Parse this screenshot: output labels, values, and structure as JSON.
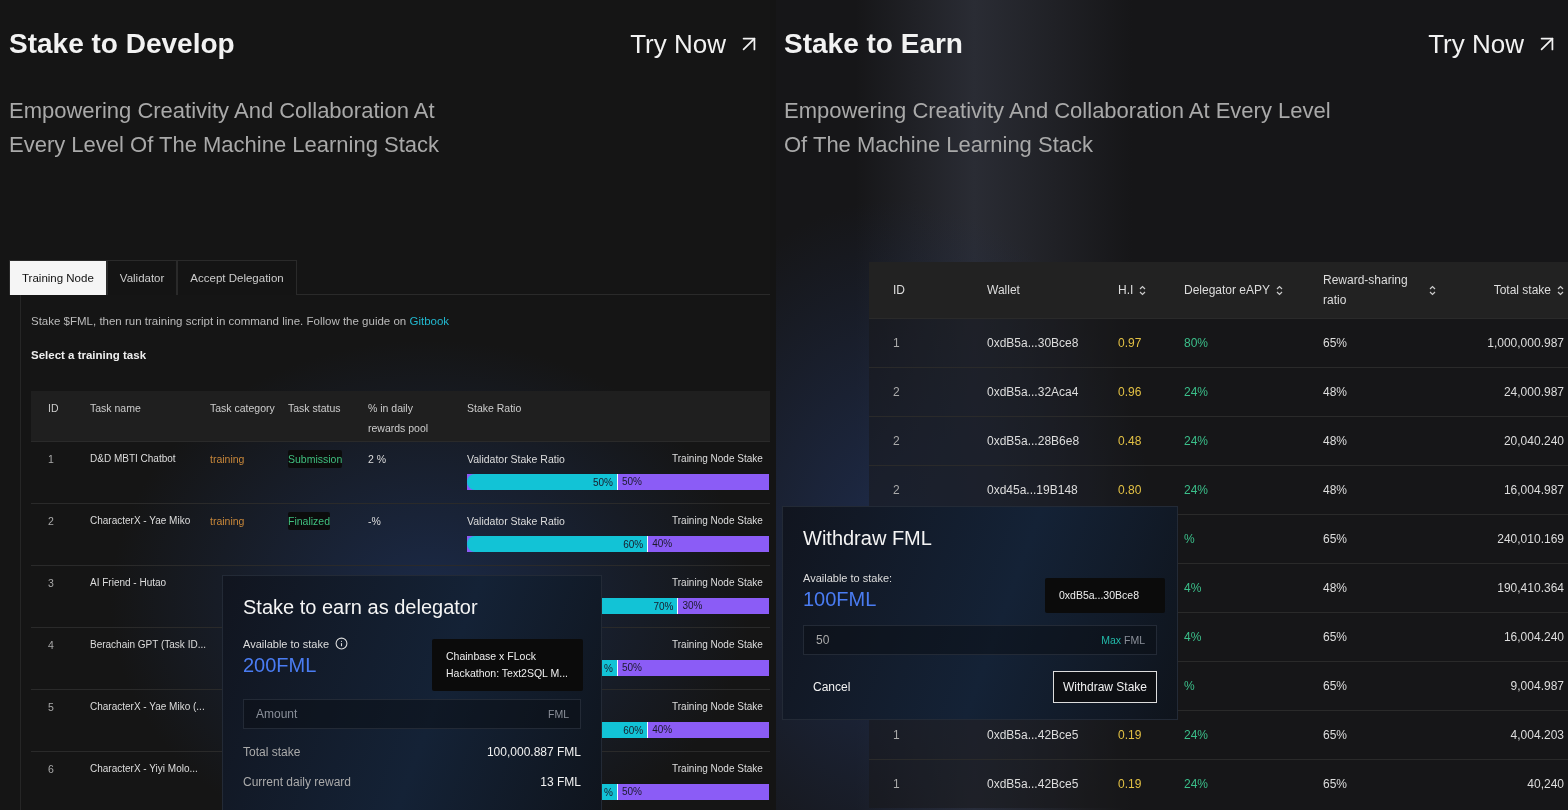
{
  "left": {
    "title": "Stake to Develop",
    "cta": "Try Now",
    "subtitle": "Empowering Creativity And Collaboration At Every Level Of The Machine Learning Stack",
    "tabs": [
      {
        "label": "Training Node",
        "selected": true
      },
      {
        "label": "Validator",
        "selected": false
      },
      {
        "label": "Accept Delegation",
        "selected": false
      }
    ],
    "intro": {
      "text": "Stake $FML, then run training script in command line. Follow the guide on",
      "link": "Gitbook"
    },
    "section_label": "Select a training task",
    "table": {
      "columns": [
        "ID",
        "Task name",
        "Task category",
        "Task status",
        "% in daily rewards pool",
        "Stake Ratio"
      ],
      "rows": [
        {
          "id": "1",
          "name": "D&D MBTI Chatbot",
          "category": "training",
          "status": "Submission",
          "pool": "2 %",
          "validator_label": "Validator Stake Ratio",
          "node_label": "Training Node Stake",
          "bar": {
            "level": 0.5,
            "left_label": "50%",
            "right_label": "50%"
          }
        },
        {
          "id": "2",
          "name": "CharacterX - Yae Miko",
          "category": "training",
          "status": "Finalized",
          "pool": "-%",
          "validator_label": "Validator Stake Ratio",
          "node_label": "Training Node Stake",
          "bar": {
            "level": 0.6,
            "left_label": "60%",
            "right_label": "40%"
          }
        },
        {
          "id": "3",
          "name": "AI Friend - Hutao",
          "node_label": "Training Node Stake",
          "bar": {
            "level": 0.7,
            "left_label": "70%",
            "right_label": "30%"
          }
        },
        {
          "id": "4",
          "name": "Berachain GPT (Task ID...",
          "node_label": "Training Node Stake",
          "bar": {
            "level": 0.5,
            "left_label": "%",
            "right_label": "50%"
          }
        },
        {
          "id": "5",
          "name": "CharacterX - Yae Miko (...",
          "node_label": "Training Node Stake",
          "bar": {
            "level": 0.6,
            "left_label": "60%",
            "right_label": "40%"
          }
        },
        {
          "id": "6",
          "name": "CharacterX - Yiyi Molo...",
          "node_label": "Training Node Stake",
          "bar": {
            "level": 0.5,
            "left_label": "%",
            "right_label": "50%"
          }
        }
      ]
    },
    "modal": {
      "title": "Stake to earn as delegator",
      "available_label": "Available to stake",
      "available_value": "200FML",
      "tooltip": "Chainbase x FLock Hackathon: Text2SQL M...",
      "amount": {
        "placeholder": "Amount",
        "suffix": "FML"
      },
      "stats": [
        {
          "label": "Total stake",
          "value": "100,000.887 FML"
        },
        {
          "label": "Current daily reward",
          "value": "13 FML"
        }
      ]
    }
  },
  "right": {
    "title": "Stake to Earn",
    "cta": "Try Now",
    "subtitle": "Empowering Creativity And Collaboration At Every Level Of The Machine Learning Stack",
    "table": {
      "columns": [
        {
          "label": "ID",
          "sortable": false
        },
        {
          "label": "Wallet",
          "sortable": false
        },
        {
          "label": "H.I",
          "sortable": true
        },
        {
          "label": "Delegator eAPY",
          "sortable": true
        },
        {
          "label": "Reward-sharing ratio",
          "sortable": true
        },
        {
          "label": "Total stake",
          "sortable": true
        }
      ],
      "rows": [
        {
          "id": "1",
          "wallet": "0xdB5a...30Bce8",
          "hi": "0.97",
          "eapy": "80%",
          "ratio": "65%",
          "total": "1,000,000.987"
        },
        {
          "id": "2",
          "wallet": "0xdB5a...32Aca4",
          "hi": "0.96",
          "eapy": "24%",
          "ratio": "48%",
          "total": "24,000.987"
        },
        {
          "id": "2",
          "wallet": "0xdB5a...28B6e8",
          "hi": "0.48",
          "eapy": "24%",
          "ratio": "48%",
          "total": "20,040.240"
        },
        {
          "id": "2",
          "wallet": "0xd45a...19B148",
          "hi": "0.80",
          "eapy": "24%",
          "ratio": "48%",
          "total": "16,004.987"
        },
        {
          "eapy": "%",
          "ratio": "65%",
          "total": "240,010.169"
        },
        {
          "eapy": "4%",
          "ratio": "48%",
          "total": "190,410.364"
        },
        {
          "eapy": "4%",
          "ratio": "65%",
          "total": "16,004.240"
        },
        {
          "eapy": "%",
          "ratio": "65%",
          "total": "9,004.987"
        },
        {
          "id": "1",
          "wallet": "0xdB5a...42Bce5",
          "hi": "0.19",
          "eapy": "24%",
          "ratio": "65%",
          "total": "4,004.203"
        },
        {
          "id": "1",
          "wallet": "0xdB5a...42Bce5",
          "hi": "0.19",
          "eapy": "24%",
          "ratio": "65%",
          "total": "40,240"
        }
      ]
    },
    "modal": {
      "title": "Withdraw FML",
      "available_label": "Available to stake:",
      "available_value": "100FML",
      "tooltip": "0xdB5a...30Bce8",
      "input": {
        "value": "50",
        "max_label": "Max",
        "suffix": "FML"
      },
      "buttons": [
        {
          "label": "Cancel",
          "kind": "text"
        },
        {
          "label": "Withdraw Stake",
          "kind": "outlined"
        }
      ]
    }
  }
}
